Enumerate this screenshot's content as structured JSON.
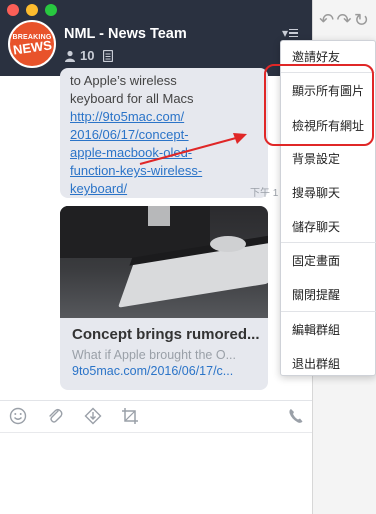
{
  "header": {
    "group_title": "NML - News Team",
    "member_count": "10",
    "avatar_line1": "BREAKING",
    "avatar_line2": "NEWS",
    "menu_glyph": "▾≡"
  },
  "messages": {
    "bubble": {
      "text_top": "to Apple’s wireless",
      "text_line2": "keyboard for all Macs",
      "link_lines": [
        "http://9to5mac.com/",
        "2016/06/17/concept-",
        "apple-macbook-oled-",
        "function-keys-wireless-",
        "keyboard/"
      ]
    },
    "time": "下午 1",
    "card": {
      "title": "Concept brings rumored...",
      "description": "What if Apple brought the O...",
      "url": "9to5mac.com/2016/06/17/c..."
    }
  },
  "dropdown": {
    "items": [
      "邀請好友",
      "顯示所有圖片",
      "檢視所有網址",
      "背景設定",
      "搜尋聊天",
      "儲存聊天",
      "固定畫面",
      "關閉提醒",
      "編輯群組",
      "退出群組"
    ]
  },
  "composer": {
    "tools": [
      "emoji-icon",
      "attach-icon",
      "download-icon",
      "crop-icon",
      "phone-icon"
    ]
  },
  "colors": {
    "header_bg": "#2a3140",
    "bubble_bg": "#e6e8ee",
    "link": "#2b74c8",
    "annotation_red": "#e02727"
  }
}
